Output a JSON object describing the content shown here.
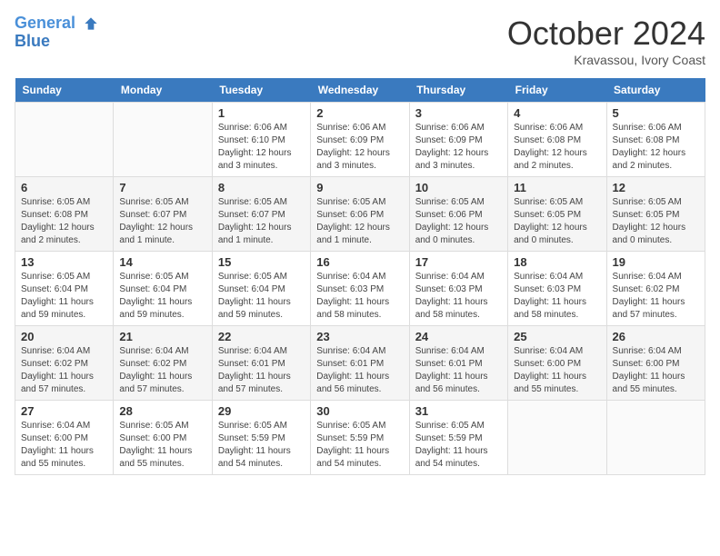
{
  "header": {
    "logo_line1": "General",
    "logo_line2": "Blue",
    "month": "October 2024",
    "location": "Kravassou, Ivory Coast"
  },
  "weekdays": [
    "Sunday",
    "Monday",
    "Tuesday",
    "Wednesday",
    "Thursday",
    "Friday",
    "Saturday"
  ],
  "weeks": [
    [
      {
        "day": "",
        "info": ""
      },
      {
        "day": "",
        "info": ""
      },
      {
        "day": "1",
        "info": "Sunrise: 6:06 AM\nSunset: 6:10 PM\nDaylight: 12 hours and 3 minutes."
      },
      {
        "day": "2",
        "info": "Sunrise: 6:06 AM\nSunset: 6:09 PM\nDaylight: 12 hours and 3 minutes."
      },
      {
        "day": "3",
        "info": "Sunrise: 6:06 AM\nSunset: 6:09 PM\nDaylight: 12 hours and 3 minutes."
      },
      {
        "day": "4",
        "info": "Sunrise: 6:06 AM\nSunset: 6:08 PM\nDaylight: 12 hours and 2 minutes."
      },
      {
        "day": "5",
        "info": "Sunrise: 6:06 AM\nSunset: 6:08 PM\nDaylight: 12 hours and 2 minutes."
      }
    ],
    [
      {
        "day": "6",
        "info": "Sunrise: 6:05 AM\nSunset: 6:08 PM\nDaylight: 12 hours and 2 minutes."
      },
      {
        "day": "7",
        "info": "Sunrise: 6:05 AM\nSunset: 6:07 PM\nDaylight: 12 hours and 1 minute."
      },
      {
        "day": "8",
        "info": "Sunrise: 6:05 AM\nSunset: 6:07 PM\nDaylight: 12 hours and 1 minute."
      },
      {
        "day": "9",
        "info": "Sunrise: 6:05 AM\nSunset: 6:06 PM\nDaylight: 12 hours and 1 minute."
      },
      {
        "day": "10",
        "info": "Sunrise: 6:05 AM\nSunset: 6:06 PM\nDaylight: 12 hours and 0 minutes."
      },
      {
        "day": "11",
        "info": "Sunrise: 6:05 AM\nSunset: 6:05 PM\nDaylight: 12 hours and 0 minutes."
      },
      {
        "day": "12",
        "info": "Sunrise: 6:05 AM\nSunset: 6:05 PM\nDaylight: 12 hours and 0 minutes."
      }
    ],
    [
      {
        "day": "13",
        "info": "Sunrise: 6:05 AM\nSunset: 6:04 PM\nDaylight: 11 hours and 59 minutes."
      },
      {
        "day": "14",
        "info": "Sunrise: 6:05 AM\nSunset: 6:04 PM\nDaylight: 11 hours and 59 minutes."
      },
      {
        "day": "15",
        "info": "Sunrise: 6:05 AM\nSunset: 6:04 PM\nDaylight: 11 hours and 59 minutes."
      },
      {
        "day": "16",
        "info": "Sunrise: 6:04 AM\nSunset: 6:03 PM\nDaylight: 11 hours and 58 minutes."
      },
      {
        "day": "17",
        "info": "Sunrise: 6:04 AM\nSunset: 6:03 PM\nDaylight: 11 hours and 58 minutes."
      },
      {
        "day": "18",
        "info": "Sunrise: 6:04 AM\nSunset: 6:03 PM\nDaylight: 11 hours and 58 minutes."
      },
      {
        "day": "19",
        "info": "Sunrise: 6:04 AM\nSunset: 6:02 PM\nDaylight: 11 hours and 57 minutes."
      }
    ],
    [
      {
        "day": "20",
        "info": "Sunrise: 6:04 AM\nSunset: 6:02 PM\nDaylight: 11 hours and 57 minutes."
      },
      {
        "day": "21",
        "info": "Sunrise: 6:04 AM\nSunset: 6:02 PM\nDaylight: 11 hours and 57 minutes."
      },
      {
        "day": "22",
        "info": "Sunrise: 6:04 AM\nSunset: 6:01 PM\nDaylight: 11 hours and 57 minutes."
      },
      {
        "day": "23",
        "info": "Sunrise: 6:04 AM\nSunset: 6:01 PM\nDaylight: 11 hours and 56 minutes."
      },
      {
        "day": "24",
        "info": "Sunrise: 6:04 AM\nSunset: 6:01 PM\nDaylight: 11 hours and 56 minutes."
      },
      {
        "day": "25",
        "info": "Sunrise: 6:04 AM\nSunset: 6:00 PM\nDaylight: 11 hours and 55 minutes."
      },
      {
        "day": "26",
        "info": "Sunrise: 6:04 AM\nSunset: 6:00 PM\nDaylight: 11 hours and 55 minutes."
      }
    ],
    [
      {
        "day": "27",
        "info": "Sunrise: 6:04 AM\nSunset: 6:00 PM\nDaylight: 11 hours and 55 minutes."
      },
      {
        "day": "28",
        "info": "Sunrise: 6:05 AM\nSunset: 6:00 PM\nDaylight: 11 hours and 55 minutes."
      },
      {
        "day": "29",
        "info": "Sunrise: 6:05 AM\nSunset: 5:59 PM\nDaylight: 11 hours and 54 minutes."
      },
      {
        "day": "30",
        "info": "Sunrise: 6:05 AM\nSunset: 5:59 PM\nDaylight: 11 hours and 54 minutes."
      },
      {
        "day": "31",
        "info": "Sunrise: 6:05 AM\nSunset: 5:59 PM\nDaylight: 11 hours and 54 minutes."
      },
      {
        "day": "",
        "info": ""
      },
      {
        "day": "",
        "info": ""
      }
    ]
  ]
}
